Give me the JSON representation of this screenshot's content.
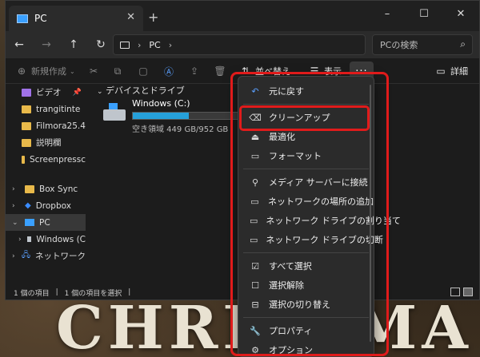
{
  "wallpaper": {
    "text": "CHRISTMA"
  },
  "window": {
    "tab_title": "PC",
    "controls": {
      "minimize": "–",
      "maximize": "☐",
      "close": "✕"
    }
  },
  "navbar": {
    "address": "PC",
    "search_placeholder": "PCの検索"
  },
  "toolbar": {
    "new_label": "新規作成",
    "sort_label": "並べ替え",
    "view_label": "表示",
    "more_label": "···",
    "details_label": "詳細"
  },
  "sidebar": {
    "pinned": [
      {
        "label": "ビデオ"
      },
      {
        "label": "trangitinte"
      },
      {
        "label": "Filmora25.4"
      },
      {
        "label": "説明欄"
      },
      {
        "label": "Screenpressc"
      }
    ],
    "tree": [
      {
        "label": "Box Sync"
      },
      {
        "label": "Dropbox"
      },
      {
        "label": "PC"
      },
      {
        "label": "Windows (C"
      },
      {
        "label": "ネットワーク"
      }
    ]
  },
  "content": {
    "group_title": "デバイスとドライブ",
    "drive": {
      "name": "Windows (C:)",
      "space": "空き領域 449 GB/952 GB",
      "used_fraction": 0.53
    }
  },
  "status": {
    "items": "1 個の項目",
    "selected": "1 個の項目を選択"
  },
  "menu": {
    "items": [
      {
        "label": "元に戻す",
        "icon": "undo-icon"
      },
      {
        "label": "クリーンアップ",
        "icon": "broom-icon"
      },
      {
        "label": "最適化",
        "icon": "drive-optimize-icon"
      },
      {
        "label": "フォーマット",
        "icon": "format-icon"
      },
      {
        "label": "メディア サーバーに接続",
        "icon": "media-server-icon"
      },
      {
        "label": "ネットワークの場所の追加",
        "icon": "network-location-icon"
      },
      {
        "label": "ネットワーク ドライブの割り当て",
        "icon": "map-drive-icon"
      },
      {
        "label": "ネットワーク ドライブの切断",
        "icon": "disconnect-drive-icon"
      },
      {
        "label": "すべて選択",
        "icon": "select-all-icon"
      },
      {
        "label": "選択解除",
        "icon": "select-none-icon"
      },
      {
        "label": "選択の切り替え",
        "icon": "invert-selection-icon"
      },
      {
        "label": "プロパティ",
        "icon": "properties-icon"
      },
      {
        "label": "オプション",
        "icon": "options-icon"
      }
    ]
  },
  "colors": {
    "annotation": "#e01b1b",
    "accent": "#26a0da"
  }
}
